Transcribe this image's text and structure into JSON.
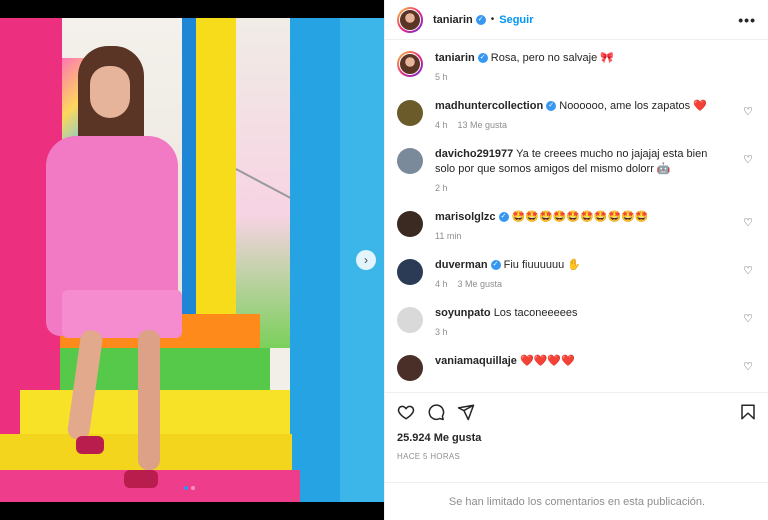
{
  "post": {
    "author": "taniarin",
    "follow_label": "Seguir",
    "separator": "•",
    "more_label": "•••",
    "caption": "Rosa, pero no salvaje 🎀",
    "caption_time": "5 h",
    "carousel": {
      "current": 1,
      "total": 2
    }
  },
  "comments": [
    {
      "user": "madhuntercollection",
      "verified": true,
      "text": "Noooooo, ame los zapatos ❤️",
      "time": "4 h",
      "likes": "13 Me gusta",
      "avatar_color": "#6b5b2a"
    },
    {
      "user": "davicho291977",
      "verified": false,
      "text": "Ya te creees mucho no jajajaj esta bien solo por que somos amigos del mismo dolorr 🤖",
      "time": "2 h",
      "likes": "",
      "avatar_color": "#7a8a9a"
    },
    {
      "user": "marisolglzc",
      "verified": true,
      "text": "🤩🤩🤩🤩🤩🤩🤩🤩🤩🤩",
      "time": "11 min",
      "likes": "",
      "avatar_color": "#3a2a22"
    },
    {
      "user": "duverman",
      "verified": true,
      "text": "Fiu fiuuuuuu ✋",
      "time": "4 h",
      "likes": "3 Me gusta",
      "avatar_color": "#2b3a55"
    },
    {
      "user": "soyunpato",
      "verified": false,
      "text": "Los taconeeeees",
      "time": "3 h",
      "likes": "",
      "avatar_color": "#d9d9d9"
    },
    {
      "user": "vaniamaquillaje",
      "verified": false,
      "text": "❤️❤️❤️❤️",
      "time": "",
      "likes": "",
      "avatar_color": "#4a2e28"
    }
  ],
  "actions": {
    "likes": "25.924 Me gusta",
    "posted_ago": "HACE 5 HORAS",
    "comments_limited": "Se han limitado los comentarios en esta publicación."
  },
  "icons": {
    "like": "heart-icon",
    "comment": "comment-icon",
    "share": "share-icon",
    "save": "bookmark-icon",
    "next": "chevron-right-icon",
    "verified": "verified-badge-icon"
  },
  "colors": {
    "follow": "#0095f6",
    "verified": "#3897f0",
    "carousel_active_dot": "#2f95f0",
    "meta": "#8e8e8e"
  }
}
